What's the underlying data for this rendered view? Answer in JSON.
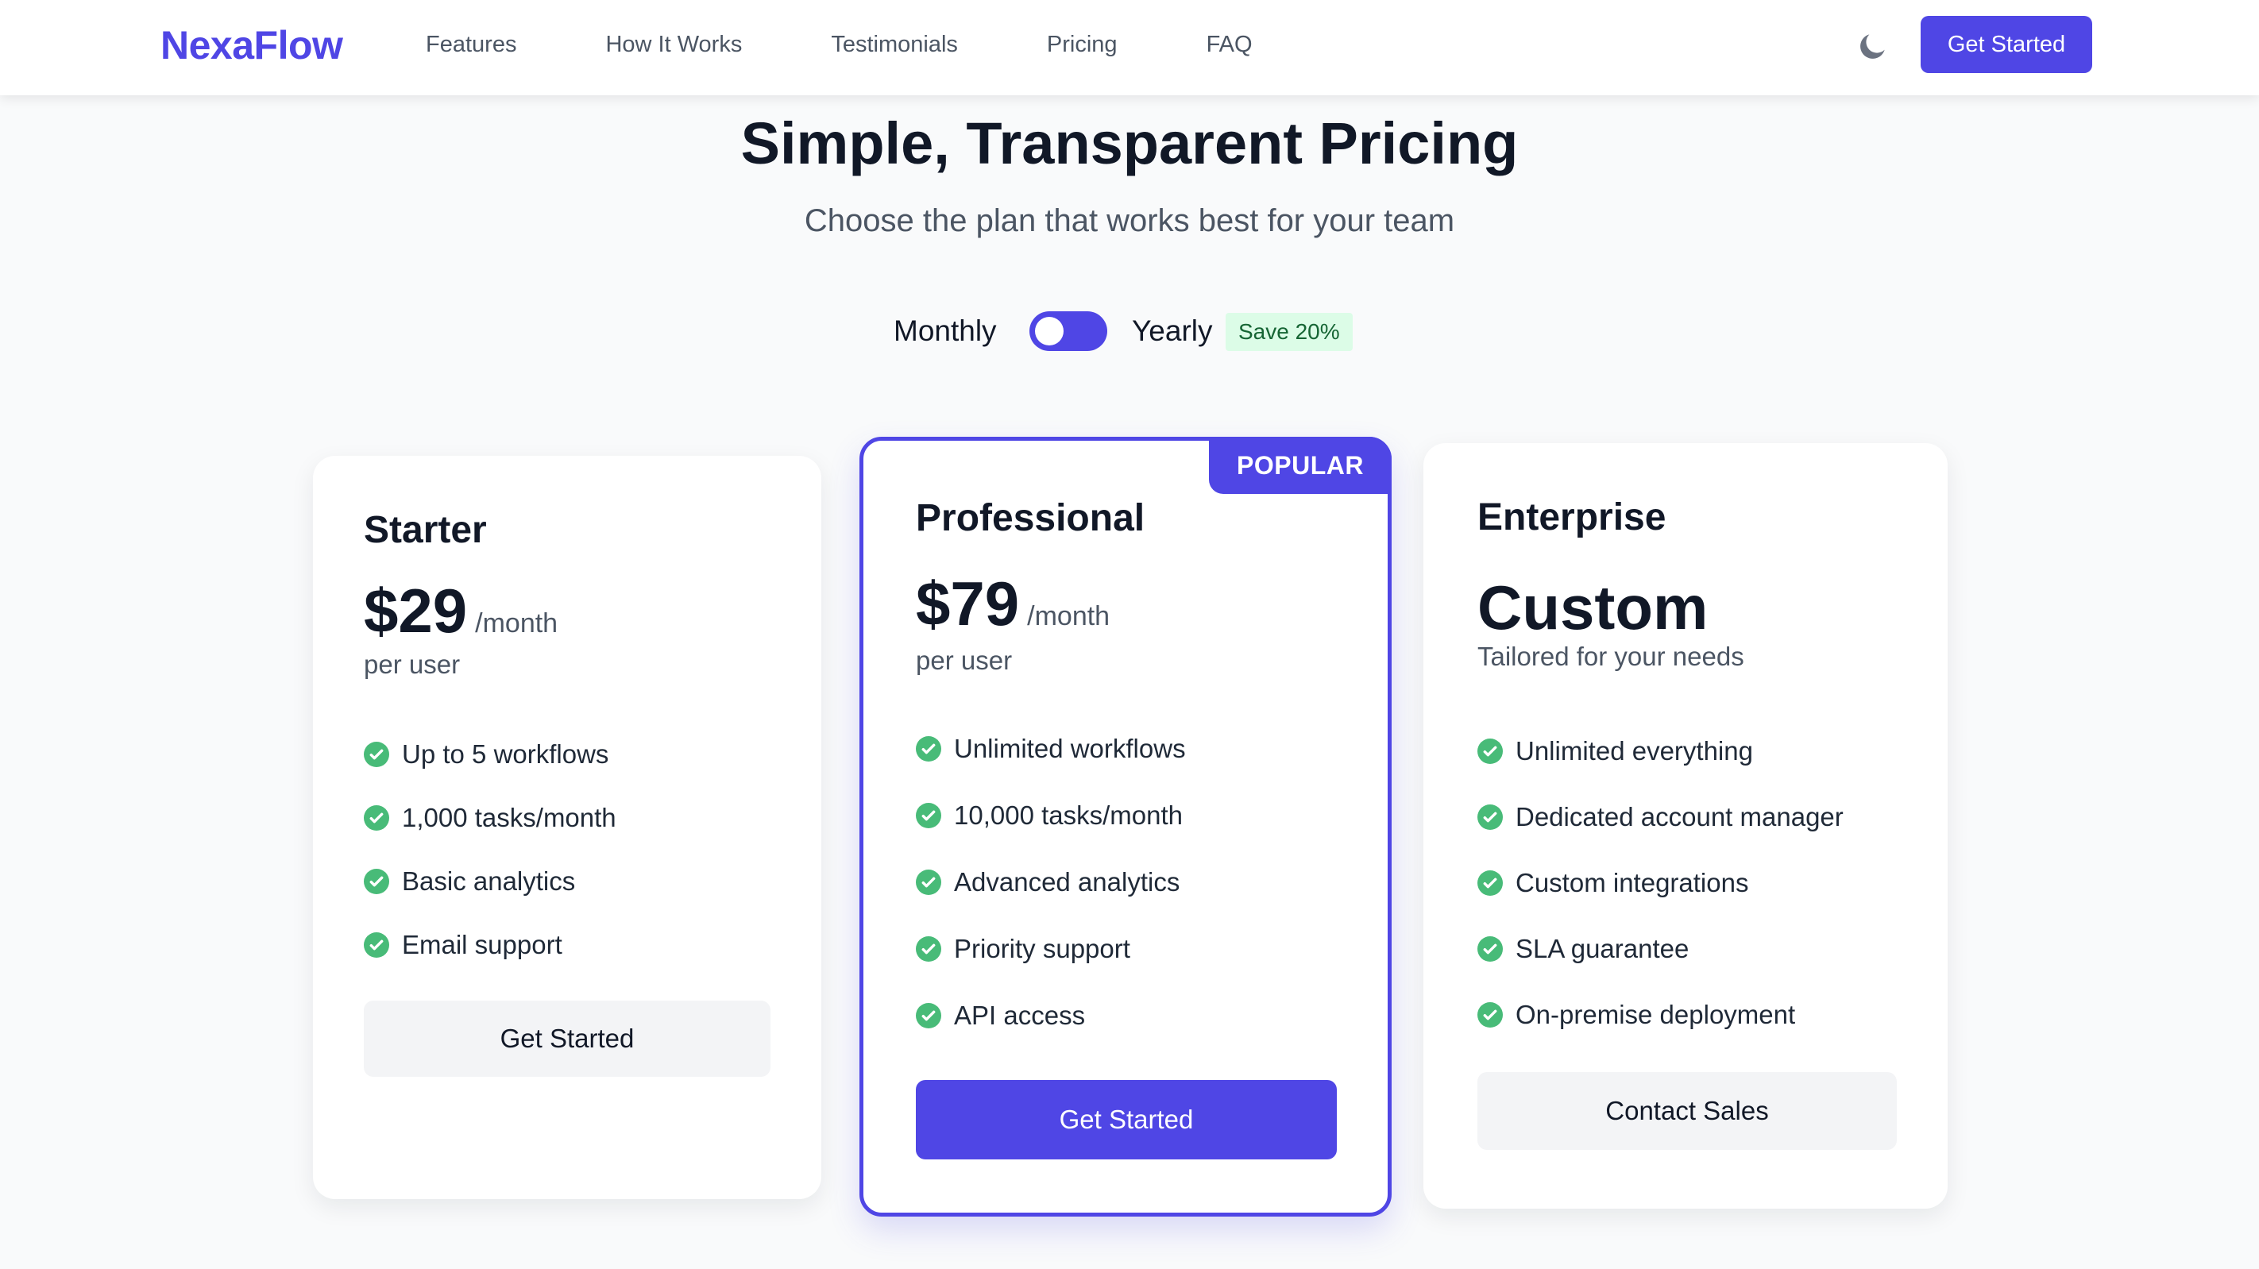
{
  "nav": {
    "logo": "NexaFlow",
    "links": [
      "Features",
      "How It Works",
      "Testimonials",
      "Pricing",
      "FAQ"
    ],
    "cta": "Get Started",
    "theme_icon": "moon-icon"
  },
  "hero": {
    "title": "Simple, Transparent Pricing",
    "subtitle": "Choose the plan that works best for your team"
  },
  "billing": {
    "monthly_label": "Monthly",
    "yearly_label": "Yearly",
    "save_badge": "Save 20%",
    "selected": "Monthly"
  },
  "plans": [
    {
      "name": "Starter",
      "price": "$29",
      "period": "/month",
      "note": "per user",
      "features": [
        "Up to 5 workflows",
        "1,000 tasks/month",
        "Basic analytics",
        "Email support"
      ],
      "button": "Get Started"
    },
    {
      "name": "Professional",
      "badge": "POPULAR",
      "price": "$79",
      "period": "/month",
      "note": "per user",
      "features": [
        "Unlimited workflows",
        "10,000 tasks/month",
        "Advanced analytics",
        "Priority support",
        "API access"
      ],
      "button": "Get Started"
    },
    {
      "name": "Enterprise",
      "price": "Custom",
      "period": "",
      "note": "Tailored for your needs",
      "features": [
        "Unlimited everything",
        "Dedicated account manager",
        "Custom integrations",
        "SLA guarantee",
        "On-premise deployment"
      ],
      "button": "Contact Sales"
    }
  ],
  "colors": {
    "brand": "#4f46e5",
    "check": "#48bb78",
    "badge_bg": "#dcfce7",
    "badge_text": "#166534"
  }
}
